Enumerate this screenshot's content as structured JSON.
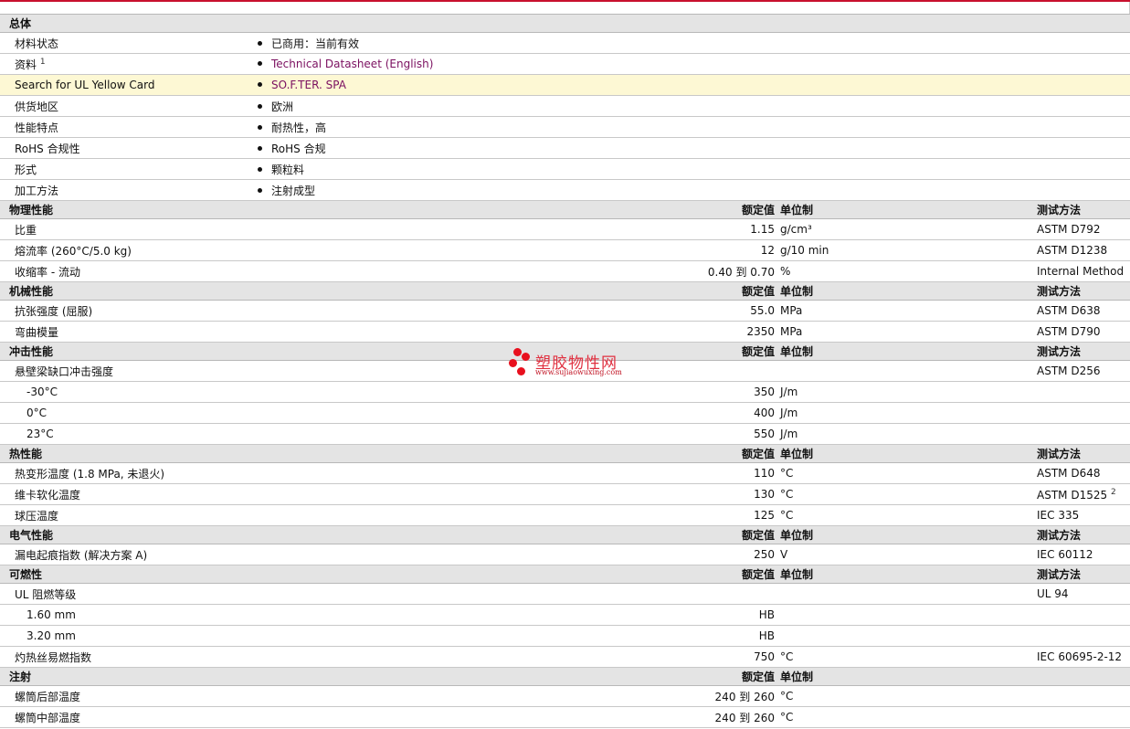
{
  "general": {
    "title": "总体",
    "rows": [
      {
        "label": "材料状态",
        "value": "已商用：当前有效"
      },
      {
        "label": "资料",
        "sup": "1",
        "value": "Technical Datasheet (English)",
        "link": true
      },
      {
        "label": "Search for UL Yellow Card",
        "value": "SO.F.TER. SPA",
        "link": true,
        "highlight": true
      },
      {
        "label": "供货地区",
        "value": "欧洲"
      },
      {
        "label": "性能特点",
        "value": "耐热性，高"
      },
      {
        "label": "RoHS 合规性",
        "value": "RoHS 合规"
      },
      {
        "label": "形式",
        "value": "颗粒料"
      },
      {
        "label": "加工方法",
        "value": "注射成型"
      }
    ]
  },
  "headers": {
    "nominal": "额定值",
    "unit": "单位制",
    "method": "测试方法"
  },
  "sections": [
    {
      "title": "物理性能",
      "method_header": true,
      "rows": [
        {
          "label": "比重",
          "value": "1.15",
          "unit": "g/cm³",
          "method": "ASTM D792"
        },
        {
          "label": "熔流率  (260°C/5.0 kg)",
          "value": "12",
          "unit": "g/10 min",
          "method": "ASTM D1238"
        },
        {
          "label": "收缩率  - 流动",
          "value": "0.40 到  0.70",
          "unit": "%",
          "method": "Internal Method"
        }
      ]
    },
    {
      "title": "机械性能",
      "method_header": true,
      "rows": [
        {
          "label": "抗张强度  (屈服)",
          "value": "55.0",
          "unit": "MPa",
          "method": "ASTM D638"
        },
        {
          "label": "弯曲模量",
          "value": "2350",
          "unit": "MPa",
          "method": "ASTM D790"
        }
      ]
    },
    {
      "title": "冲击性能",
      "method_header": true,
      "rows": [
        {
          "label": "悬壁梁缺口冲击强度",
          "value": "",
          "unit": "",
          "method": "ASTM D256"
        },
        {
          "label": "-30°C",
          "indent": true,
          "value": "350",
          "unit": "J/m",
          "method": ""
        },
        {
          "label": "0°C",
          "indent": true,
          "value": "400",
          "unit": "J/m",
          "method": ""
        },
        {
          "label": "23°C",
          "indent": true,
          "value": "550",
          "unit": "J/m",
          "method": ""
        }
      ]
    },
    {
      "title": "热性能",
      "method_header": true,
      "rows": [
        {
          "label": "热变形温度  (1.8 MPa, 未退火)",
          "value": "110",
          "unit": "°C",
          "method": "ASTM D648"
        },
        {
          "label": "维卡软化温度",
          "value": "130",
          "unit": "°C",
          "method": "ASTM D1525",
          "msup": "2"
        },
        {
          "label": "球压温度",
          "value": "125",
          "unit": "°C",
          "method": "IEC 335"
        }
      ]
    },
    {
      "title": "电气性能",
      "method_header": true,
      "rows": [
        {
          "label": "漏电起痕指数  (解决方案  A)",
          "value": "250",
          "unit": "V",
          "method": "IEC 60112"
        }
      ]
    },
    {
      "title": "可燃性",
      "method_header": true,
      "rows": [
        {
          "label": "UL 阻燃等级",
          "value": "",
          "unit": "",
          "method": "UL 94"
        },
        {
          "label": "1.60 mm",
          "indent": true,
          "value": "HB",
          "unit": "",
          "method": ""
        },
        {
          "label": "3.20 mm",
          "indent": true,
          "value": "HB",
          "unit": "",
          "method": ""
        },
        {
          "label": "灼热丝易燃指数",
          "value": "750",
          "unit": "°C",
          "method": "IEC 60695-2-12"
        }
      ]
    },
    {
      "title": "注射",
      "method_header": false,
      "rows": [
        {
          "label": "螺筒后部温度",
          "value": "240 到  260",
          "unit": "°C",
          "method": ""
        },
        {
          "label": "螺筒中部温度",
          "value": "240 到  260",
          "unit": "°C",
          "method": ""
        }
      ]
    }
  ],
  "watermark": {
    "name": "塑胶物性网",
    "url": "www.sujiaowuxing.com"
  }
}
